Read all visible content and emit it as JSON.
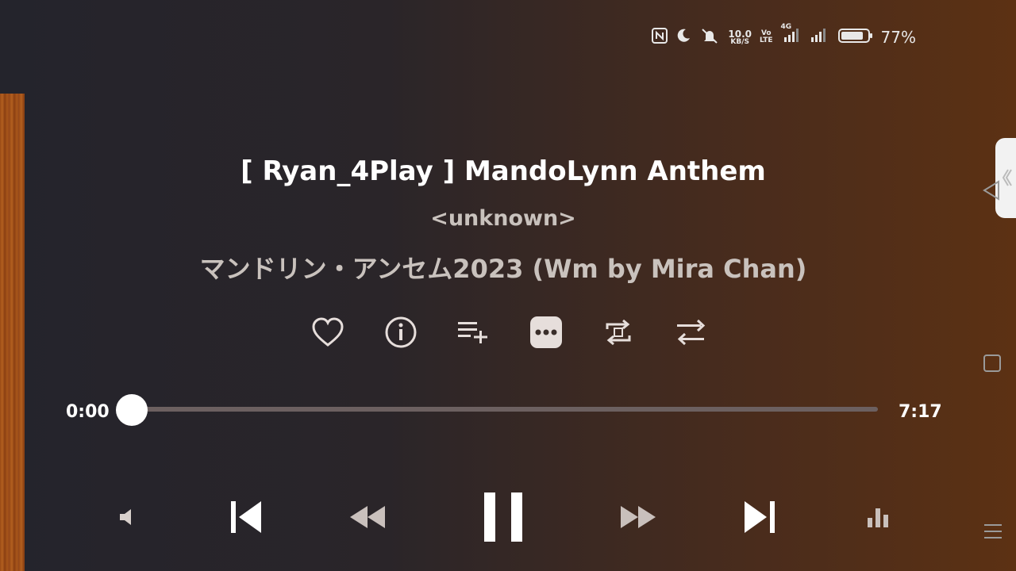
{
  "status_bar": {
    "net_speed": "10.0",
    "net_unit": "KB/S",
    "volte_top": "Vo",
    "volte_bottom": "LTE",
    "network_type": "4G",
    "battery_percent": "77%"
  },
  "track": {
    "title": "[ Ryan_4Play ] MandoLynn Anthem",
    "artist": "<unknown>",
    "album": "マンドリン・アンセム2023 (Wm by Mira Chan)"
  },
  "progress": {
    "current": "0:00",
    "total": "7:17",
    "fraction": 0.0
  },
  "actions": [
    "heart-icon",
    "info-icon",
    "add-to-playlist-icon",
    "more-icon",
    "repeat-one-icon",
    "shuffle-icon"
  ],
  "controls": [
    "volume-icon",
    "previous-icon",
    "rewind-icon",
    "pause-icon",
    "fast-forward-icon",
    "next-icon",
    "equalizer-icon"
  ],
  "nav_bar": [
    "back-icon",
    "home-icon",
    "menu-icon"
  ],
  "colors": {
    "accent": "#ffffff",
    "secondary_text": "#c9c2bd",
    "track": "#6c6060"
  }
}
